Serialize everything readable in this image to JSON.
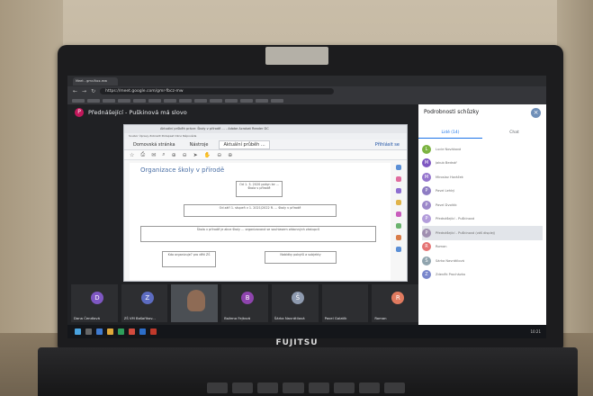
{
  "browser": {
    "tab_title": "Meet - gmr-fbcz-mw",
    "address": "https://meet.google.com/gmr-fbcz-mw"
  },
  "meet": {
    "presenter_initial": "P",
    "presenter_title": "Přednášející - Puškinová má slovo"
  },
  "document": {
    "window_title": "Aktuální průběh práce: Školy v přírodě ... - Adobe Acrobat Reader DC",
    "menu": "Soubor  Úpravy  Zobrazit  Podepsat  Okno  Nápověda",
    "tabs": [
      "Domovská stránka",
      "Nástroje",
      "Aktuální průběh ..."
    ],
    "sign_in": "Přihlásit se",
    "heading": "Organizace školy v přírodě",
    "boxes": [
      "Od 1. 3. 2020 pokyn ke ... škola v přírodě",
      "Od září 1. stupeň v 1. 2021/2022 R. ... školy v přírodě",
      "Škola v přírodě je akce školy ... organizovaná se souhlasem zákonných zástupců",
      "Kdo organizuje? pro děti ZŠ",
      "Nabídky pobytů a subjekty"
    ]
  },
  "panel": {
    "title": "Podrobnosti schůzky",
    "tab_people": "Lidé (14)",
    "tab_chat": "Chat",
    "close": "×",
    "participants": [
      {
        "initial": "L",
        "name": "Lucie Nováková",
        "color": "#7cb342"
      },
      {
        "initial": "M",
        "name": "Jakub Bednář",
        "color": "#7e57c2"
      },
      {
        "initial": "M",
        "name": "Miroslav Horáček",
        "color": "#9575cd"
      },
      {
        "initial": "P",
        "name": "Pavel Lehký",
        "color": "#8e7cc3"
      },
      {
        "initial": "P",
        "name": "Pavel Dvořák",
        "color": "#9c88c9"
      },
      {
        "initial": "P",
        "name": "Přednášející - Puškinová",
        "color": "#b39ddb"
      },
      {
        "initial": "P",
        "name": "Přednášející - Puškinová (váš displej)",
        "color": "#a08fb0"
      },
      {
        "initial": "R",
        "name": "Roman",
        "color": "#e57373"
      },
      {
        "initial": "Š",
        "name": "Šárka Navrátilová",
        "color": "#90a4ae"
      },
      {
        "initial": "Z",
        "name": "Zdeněk Procházka",
        "color": "#7986cb"
      }
    ]
  },
  "strip": [
    {
      "initial": "D",
      "name": "Dana Čendlová",
      "color": "#7e57c2"
    },
    {
      "initial": "Z",
      "name": "ZŠ VM Bašařikov...",
      "color": "#5c6bc0"
    },
    {
      "initial": "",
      "name": "",
      "color": "#8e6b55",
      "video": true
    },
    {
      "initial": "B",
      "name": "Božena Fejtová",
      "color": "#8e44ad"
    },
    {
      "initial": "Š",
      "name": "Šárka Navrátilová",
      "color": "#8e9aaf"
    },
    {
      "initial": "",
      "name": "Pavel Galatík",
      "color": "#333"
    },
    {
      "initial": "R",
      "name": "Roman",
      "color": "#e07a5f"
    }
  ],
  "laptop": {
    "brand": "FUJITSU"
  },
  "taskbar": {
    "clock": "10:21"
  }
}
